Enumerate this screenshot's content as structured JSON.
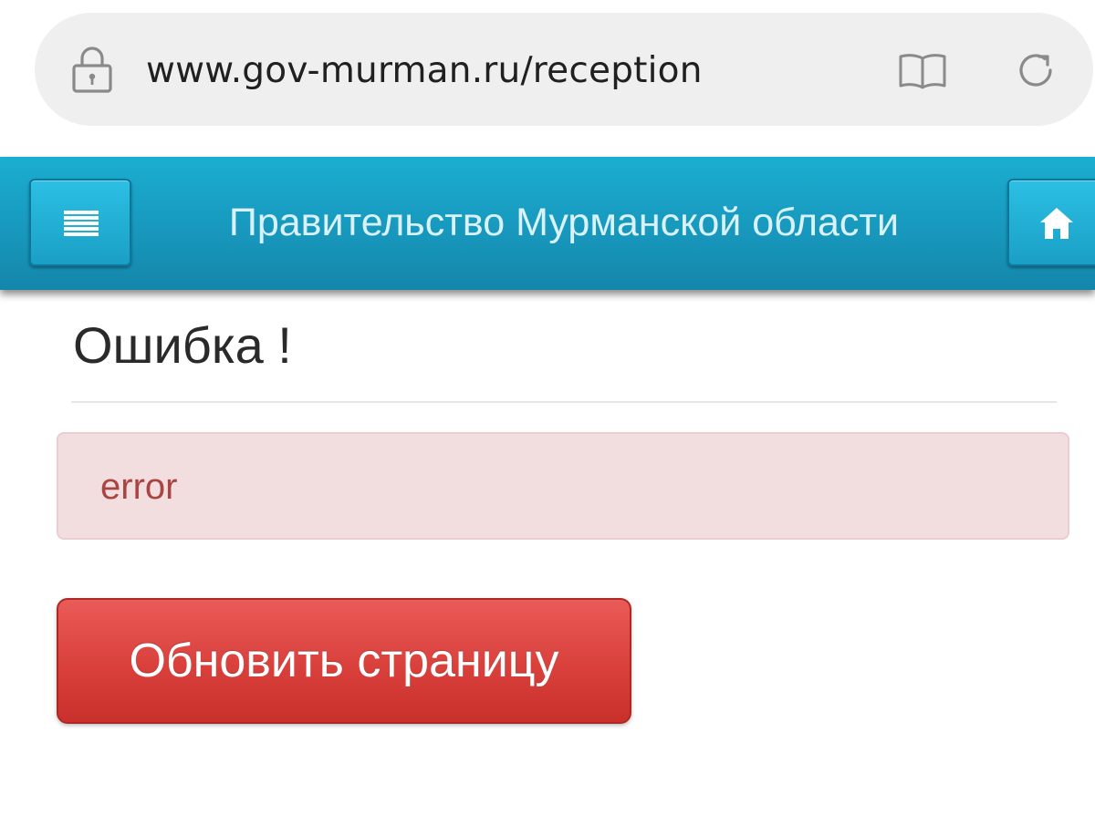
{
  "browser": {
    "url": "www.gov-murman.ru/reception",
    "icons": {
      "lock": "lock-icon",
      "reader": "reader-mode-icon",
      "reload": "reload-icon"
    }
  },
  "header": {
    "title": "Правительство Мурманской области",
    "menu_icon": "hamburger-menu-icon",
    "home_icon": "home-icon",
    "colors": {
      "bar": "#1898bd",
      "title_text": "#d9f2fa"
    }
  },
  "main": {
    "heading": "Ошибка !",
    "alert": {
      "text": "error",
      "background": "#f2dede",
      "text_color": "#a94442"
    },
    "reload_button": {
      "label": "Обновить страницу",
      "color": "#d9403c"
    }
  }
}
